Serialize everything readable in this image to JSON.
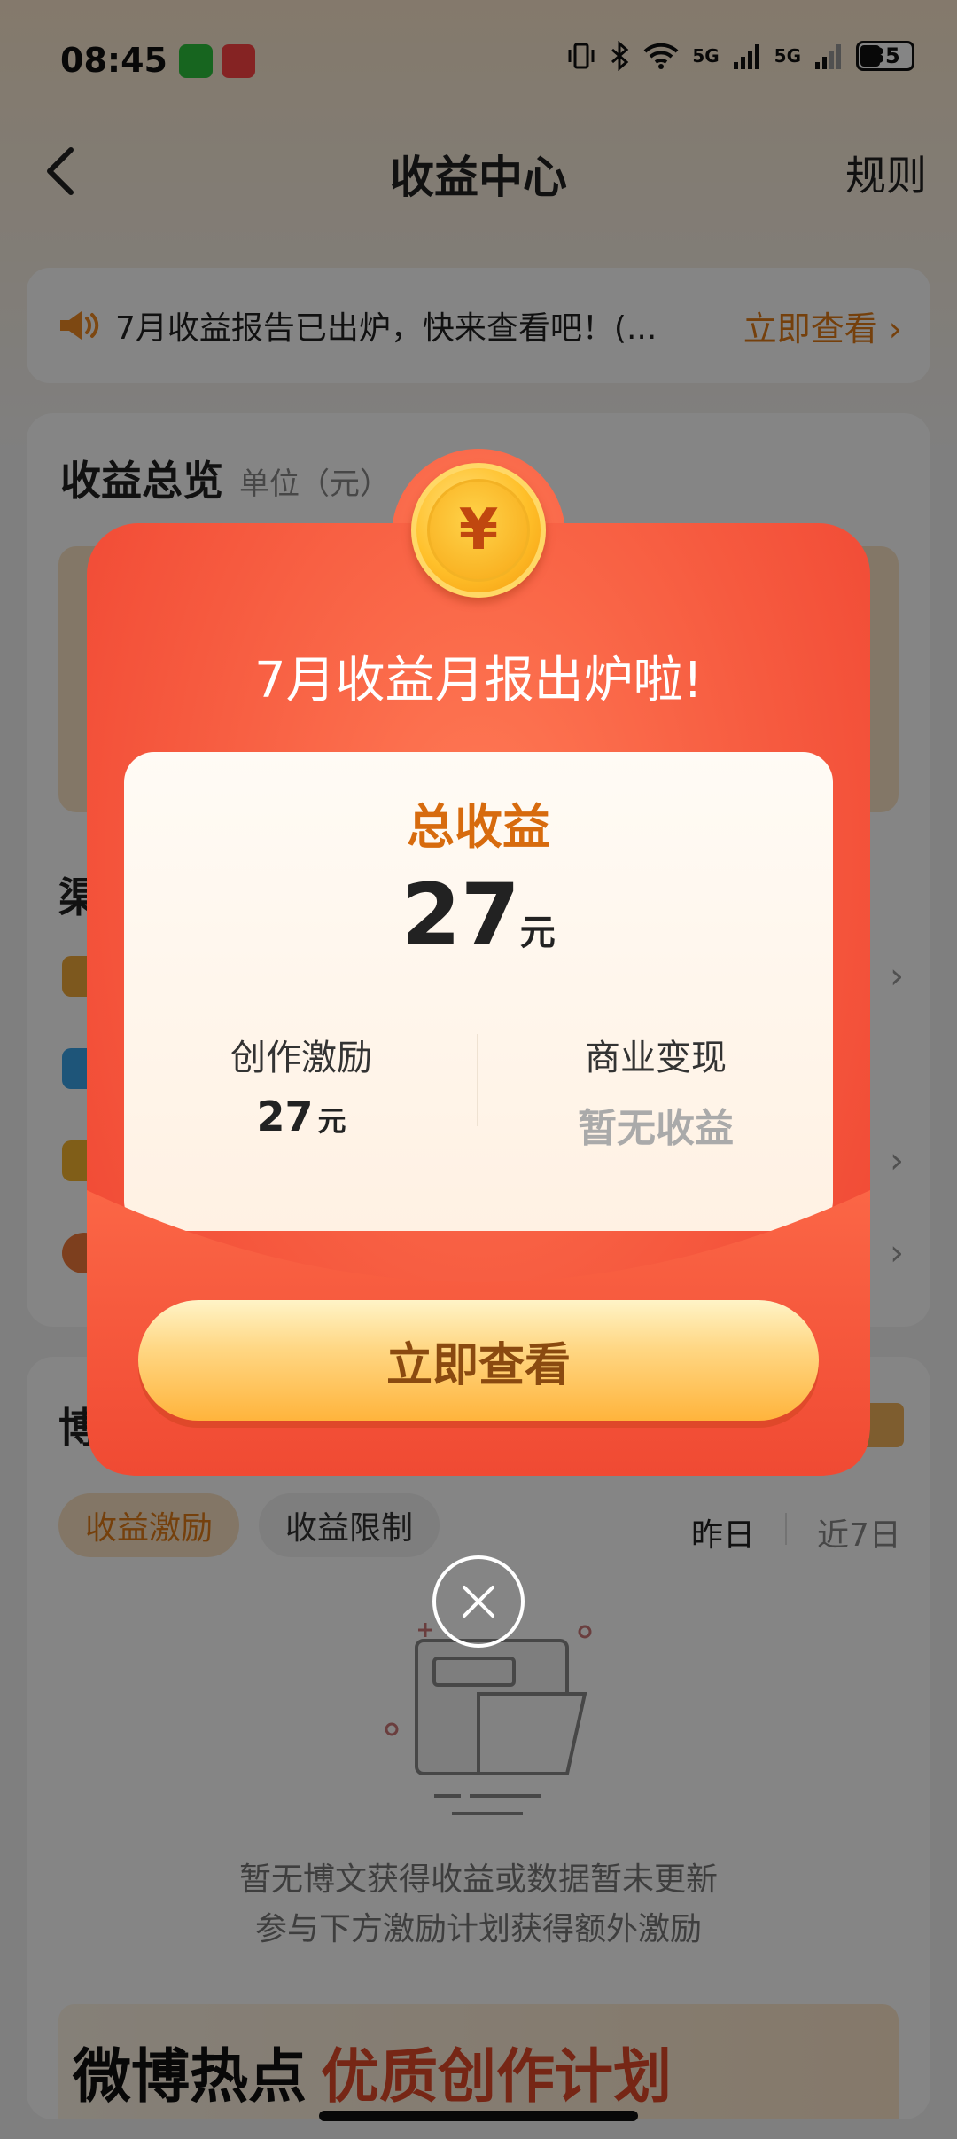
{
  "status": {
    "time": "08:45",
    "network_a": "5G",
    "network_b": "5G",
    "battery": "35"
  },
  "nav": {
    "title": "收益中心",
    "rules_label": "规则"
  },
  "notice": {
    "text": "7月收益报告已出炉，快来查看吧！(...",
    "link_label": "立即查看 ›"
  },
  "overview": {
    "title": "收益总览",
    "unit": "单位（元）",
    "channel_label": "渠"
  },
  "weibo": {
    "title": "博",
    "tabs": [
      "收益激励",
      "收益限制"
    ],
    "range_yesterday": "昨日",
    "range_7d": "近7日",
    "empty_line1": "暂无博文获得收益或数据暂未更新",
    "empty_line2": "参与下方激励计划获得额外激励",
    "banner_part1": "微博热点",
    "banner_part2": "优质创作计划"
  },
  "modal": {
    "coin_symbol": "¥",
    "headline": "7月收益月报出炉啦!",
    "total_label": "总收益",
    "total_value": "27",
    "total_unit": "元",
    "col_left_title": "创作激励",
    "col_left_value": "27",
    "col_left_unit": "元",
    "col_right_title": "商业变现",
    "col_right_value": "暂无收益",
    "cta_label": "立即查看"
  },
  "colors": {
    "accent_orange": "#e07b18",
    "modal_red": "#f65a3f",
    "coin_gold": "#ffc02a"
  },
  "icons": [
    "chevron-left-icon",
    "speaker-icon",
    "close-icon",
    "yuan-coin-icon",
    "wifi-icon",
    "bluetooth-icon",
    "vibrate-icon"
  ]
}
